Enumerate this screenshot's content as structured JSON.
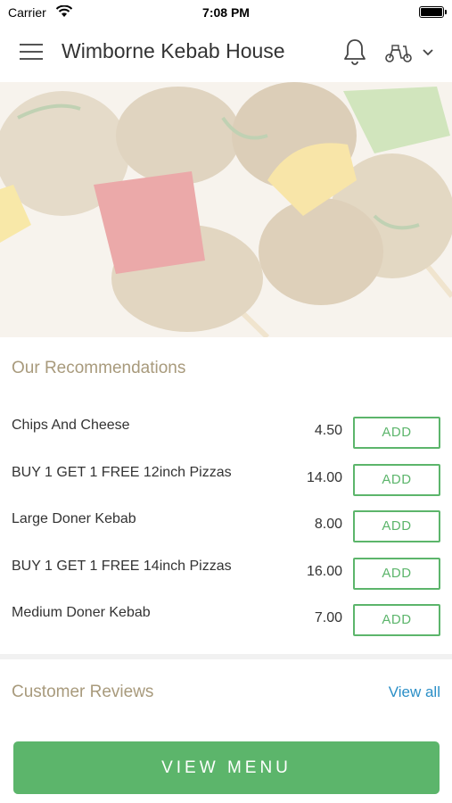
{
  "status_bar": {
    "carrier": "Carrier",
    "time": "7:08 PM"
  },
  "header": {
    "title": "Wimborne Kebab House"
  },
  "icons": {
    "menu": "hamburger-icon",
    "notifications": "bell-icon",
    "delivery": "scooter-icon",
    "dropdown": "chevron-down-icon"
  },
  "recommendations": {
    "title": "Our Recommendations",
    "items": [
      {
        "name": "Chips And Cheese",
        "price": "4.50",
        "button": "ADD"
      },
      {
        "name": "BUY 1 GET 1 FREE 12inch Pizzas",
        "price": "14.00",
        "button": "ADD"
      },
      {
        "name": "Large Doner Kebab",
        "price": "8.00",
        "button": "ADD"
      },
      {
        "name": "BUY 1 GET 1 FREE 14inch Pizzas",
        "price": "16.00",
        "button": "ADD"
      },
      {
        "name": "Medium Doner Kebab",
        "price": "7.00",
        "button": "ADD"
      }
    ]
  },
  "reviews": {
    "title": "Customer Reviews",
    "view_all": "View all"
  },
  "footer": {
    "view_menu": "VIEW MENU"
  },
  "colors": {
    "accent_green": "#5cb56b",
    "section_title": "#a89a7c",
    "link_blue": "#2b8fc7"
  }
}
